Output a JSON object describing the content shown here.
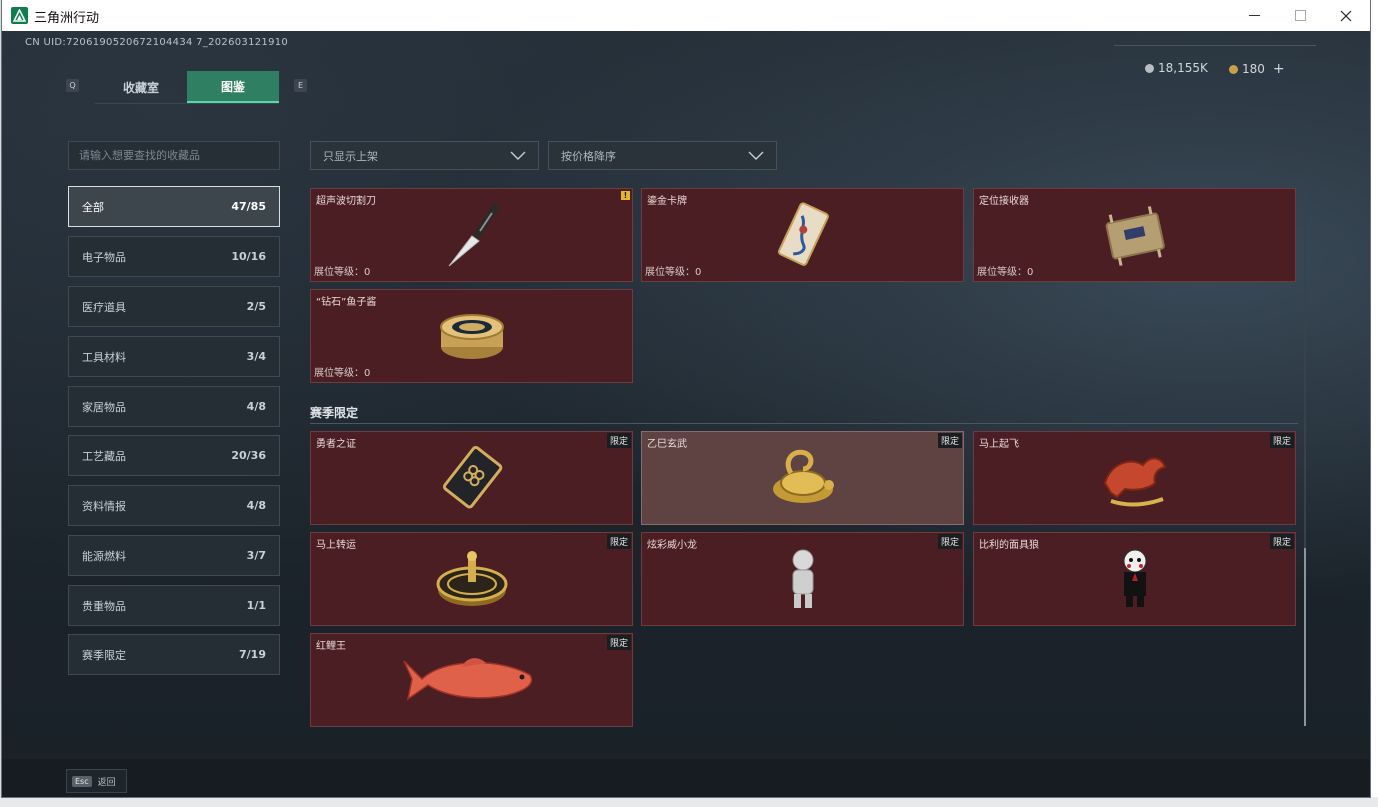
{
  "window": {
    "title": "三角洲行动"
  },
  "header": {
    "uid": "CN UID:7206190520672104434 7_202603121910",
    "currency_silver": "18,155K",
    "currency_gold": "180",
    "add_label": "+"
  },
  "tabs": {
    "prev_key": "Q",
    "next_key": "E",
    "items": [
      {
        "label": "收藏室",
        "active": false
      },
      {
        "label": "图鉴",
        "active": true
      }
    ]
  },
  "search": {
    "placeholder": "请输入想要查找的收藏品"
  },
  "categories": [
    {
      "label": "全部",
      "count": "47/85",
      "active": true
    },
    {
      "label": "电子物品",
      "count": "10/16"
    },
    {
      "label": "医疗道具",
      "count": "2/5"
    },
    {
      "label": "工具材料",
      "count": "3/4"
    },
    {
      "label": "家居物品",
      "count": "4/8"
    },
    {
      "label": "工艺藏品",
      "count": "20/36"
    },
    {
      "label": "资料情报",
      "count": "4/8"
    },
    {
      "label": "能源燃料",
      "count": "3/7"
    },
    {
      "label": "贵重物品",
      "count": "1/1"
    },
    {
      "label": "赛季限定",
      "count": "7/19"
    }
  ],
  "filters": {
    "shelf": "只显示上架",
    "sort": "按价格降序"
  },
  "items_top": [
    {
      "name": "超声波切割刀",
      "level": "展位等级：0",
      "warn": "!"
    },
    {
      "name": "鎏金卡牌",
      "level": "展位等级：0"
    },
    {
      "name": "定位接收器",
      "level": "展位等级：0"
    },
    {
      "name": "“钻石”鱼子酱",
      "level": "展位等级：0"
    }
  ],
  "section": {
    "title": "赛季限定"
  },
  "items_season": [
    {
      "name": "勇者之证",
      "tag": "限定"
    },
    {
      "name": "乙巳玄武",
      "tag": "限定"
    },
    {
      "name": "马上起飞",
      "tag": "限定"
    },
    {
      "name": "马上转运",
      "tag": "限定"
    },
    {
      "name": "炫彩威小龙",
      "tag": "限定"
    },
    {
      "name": "比利的面具狼",
      "tag": "限定"
    },
    {
      "name": "红鲤王",
      "tag": "限定"
    }
  ],
  "footer": {
    "esc_key": "Esc",
    "back_label": "返回"
  }
}
